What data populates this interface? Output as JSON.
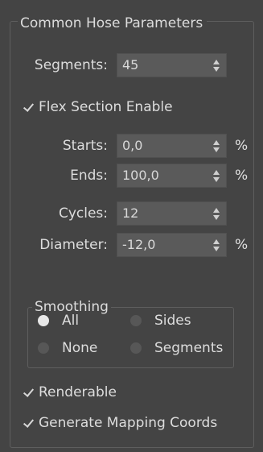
{
  "rollout": {
    "title": "Common Hose Parameters"
  },
  "segments": {
    "label": "Segments:",
    "value": "45"
  },
  "flex": {
    "label": "Flex Section Enable",
    "checked": true,
    "starts": {
      "label": "Starts:",
      "value": "0,0",
      "unit": "%"
    },
    "ends": {
      "label": "Ends:",
      "value": "100,0",
      "unit": "%"
    },
    "cycles": {
      "label": "Cycles:",
      "value": "12"
    },
    "diameter": {
      "label": "Diameter:",
      "value": "-12,0",
      "unit": "%"
    }
  },
  "smoothing": {
    "title": "Smoothing",
    "options": [
      {
        "label": "All",
        "selected": true
      },
      {
        "label": "Sides",
        "selected": false
      },
      {
        "label": "None",
        "selected": false
      },
      {
        "label": "Segments",
        "selected": false
      }
    ]
  },
  "renderable": {
    "label": "Renderable",
    "checked": true
  },
  "mapping": {
    "label": "Generate Mapping Coords",
    "checked": true
  },
  "colors": {
    "panel_bg": "#444444",
    "field_bg": "#5a5a5a",
    "text": "#dddddd",
    "radio_on": "#e8e8e8"
  }
}
